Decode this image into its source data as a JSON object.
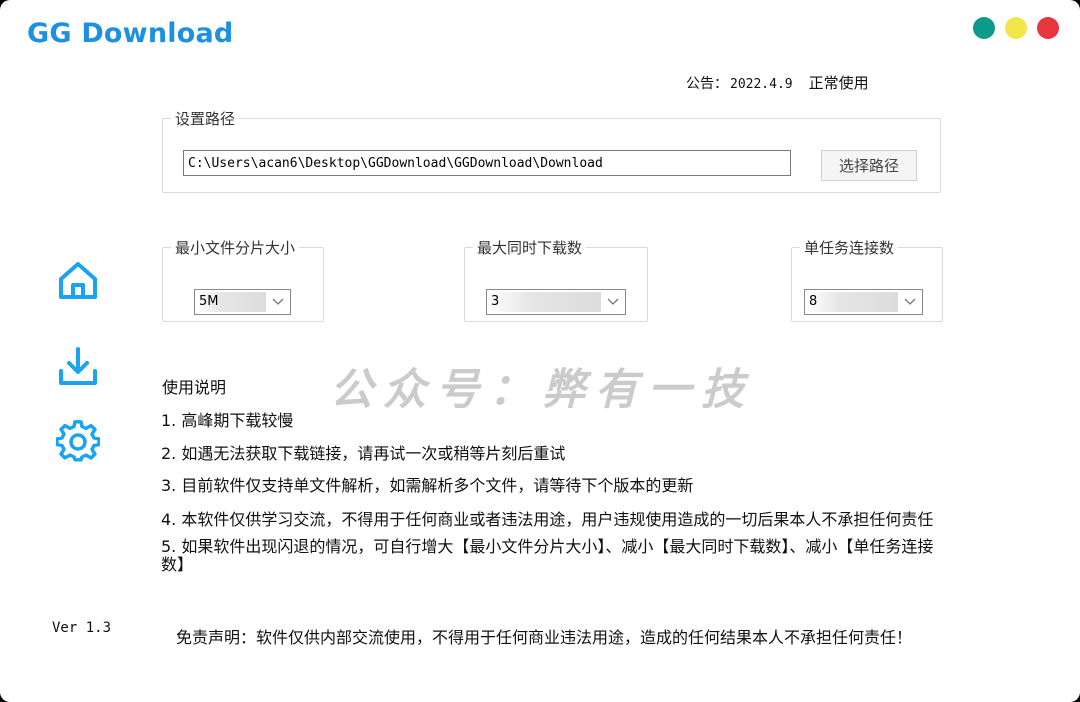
{
  "app": {
    "title": "GG Download"
  },
  "window_controls": {
    "colors": {
      "green": "#0e9a8b",
      "yellow": "#f2e64a",
      "red": "#e8363f"
    }
  },
  "notice": {
    "label": "公告：",
    "date": "2022.4.9",
    "status": "正常使用"
  },
  "path_group": {
    "legend": "设置路径",
    "path_value": "C:\\Users\\acan6\\Desktop\\GGDownload\\GGDownload\\Download",
    "button_label": "选择路径"
  },
  "settings": {
    "min_chunk": {
      "legend": "最小文件分片大小",
      "value": "5M"
    },
    "max_downloads": {
      "legend": "最大同时下载数",
      "value": "3"
    },
    "connections": {
      "legend": "单任务连接数",
      "value": "8"
    }
  },
  "sidebar": {
    "icons": [
      "home-icon",
      "download-icon",
      "settings-icon"
    ],
    "accent": "#1aa3f0"
  },
  "usage": {
    "title": "使用说明",
    "items": [
      "1. 高峰期下载较慢",
      "2. 如遇无法获取下载链接，请再试一次或稍等片刻后重试",
      "3. 目前软件仅支持单文件解析，如需解析多个文件，请等待下个版本的更新",
      "4. 本软件仅供学习交流，不得用于任何商业或者违法用途，用户违规使用造成的一切后果本人不承担任何责任",
      "5. 如果软件出现闪退的情况，可自行增大【最小文件分片大小】、减小【最大同时下载数】、减小【单任务连接数】"
    ]
  },
  "watermark": "公众号：弊有一技",
  "version": "Ver 1.3",
  "disclaimer": "免责声明：软件仅供内部交流使用，不得用于任何商业违法用途，造成的任何结果本人不承担任何责任！"
}
